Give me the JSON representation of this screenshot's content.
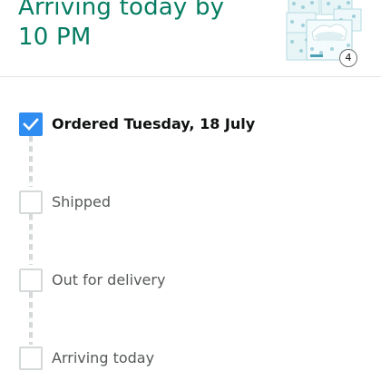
{
  "header": {
    "arrival_line1": "Arriving today by",
    "arrival_line2": "10 PM"
  },
  "product": {
    "image_icon": "tissue-box-multipack-icon",
    "quantity": "4"
  },
  "tracker": {
    "steps": [
      {
        "label": "Ordered Tuesday, 18 July",
        "completed": true
      },
      {
        "label": "Shipped",
        "completed": false
      },
      {
        "label": "Out for delivery",
        "completed": false
      },
      {
        "label": "Arriving today",
        "completed": false
      }
    ]
  },
  "colors": {
    "arrival_text": "#067d62",
    "checkbox_checked": "#2f8cf0",
    "checkbox_unchecked_border": "#d5d9d9"
  }
}
